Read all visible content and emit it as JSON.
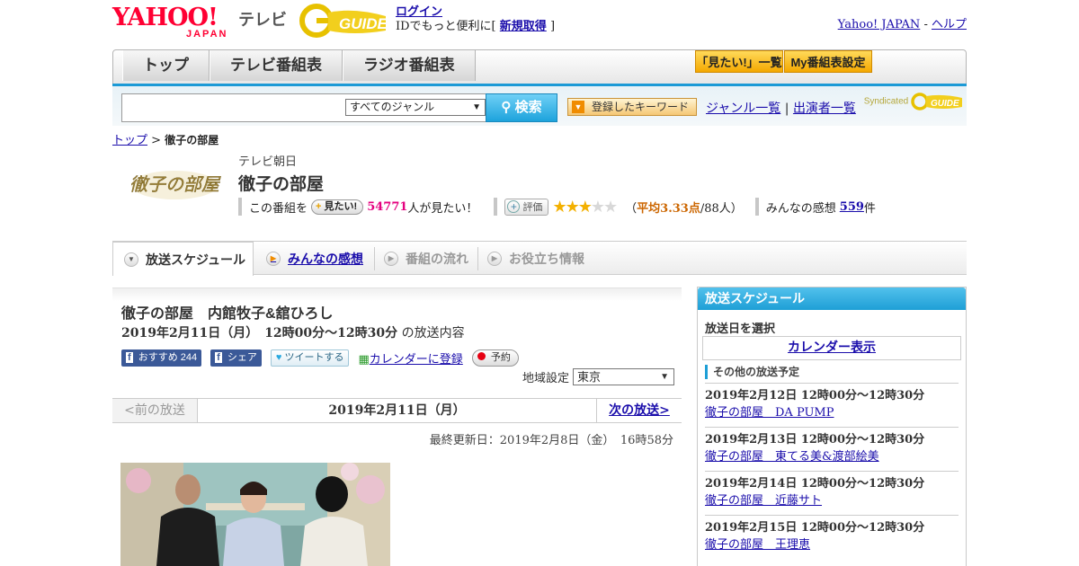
{
  "header": {
    "yahoo_logo": "YAHOO!",
    "yahoo_sub": "JAPAN",
    "tv_label": "テレビ",
    "login": "ログイン",
    "login_desc": "IDでもっと便利に[",
    "register": "新規取得",
    "login_close": "]",
    "yahoo_japan_link": "Yahoo! JAPAN",
    "dash": "-",
    "help_link": "ヘルプ"
  },
  "nav": {
    "tabs": [
      "トップ",
      "テレビ番組表",
      "ラジオ番組表"
    ],
    "mitai_list": "「見たい!」一覧",
    "my_schedule": "My番組表設定"
  },
  "search": {
    "genre": "すべてのジャンル",
    "button": "検索",
    "keyword_button": "登録したキーワード",
    "genre_list": "ジャンル一覧",
    "separator": "|",
    "cast_list": "出演者一覧",
    "syndicated": "Syndicated"
  },
  "breadcrumb": {
    "top": "トップ",
    "sep": ">",
    "current": "徹子の部屋"
  },
  "program": {
    "thumb_text": "徹子の部屋",
    "channel": "テレビ朝日",
    "title": "徹子の部屋",
    "kono_bangumi": "この番組を",
    "mitai_btn": "見たい!",
    "mitai_count": "54771",
    "mitai_suffix": "人が見たい！",
    "hyoka_btn": "評価",
    "rating_stars": 3,
    "rating_max": 5,
    "avg_open": "（",
    "avg_label": "平均3.33点",
    "avg_count": "/88人）",
    "kanso_label": "みんなの感想",
    "kanso_count": "559",
    "kanso_suffix": "件"
  },
  "subtabs": [
    "放送スケジュール",
    "みんなの感想",
    "番組の流れ",
    "お役立ち情報"
  ],
  "episode": {
    "title": "徹子の部屋　内館牧子&舘ひろし",
    "date_bold": "2019年2月11日（月）　12時00分～12時30分",
    "date_suffix": "の放送内容",
    "fb_label": "おすすめ",
    "fb_count": "244",
    "share": "シェア",
    "tweet": "ツイートする",
    "calendar": "カレンダーに登録",
    "yoyaku": "予約",
    "region_label": "地域設定",
    "region_value": "東京"
  },
  "episode_nav": {
    "prev": "<前の放送",
    "current": "2019年2月11日（月）",
    "next": "次の放送>"
  },
  "updated": "最終更新日：2019年2月8日（金）　16時58分",
  "sidebar": {
    "title": "放送スケジュール",
    "date_label": "放送日を選択",
    "calendar_link": "カレンダー表示",
    "other_label": "その他の放送予定",
    "items": [
      {
        "date": "2019年2月12日  12時00分～12時30分",
        "title": "徹子の部屋　DA PUMP"
      },
      {
        "date": "2019年2月13日  12時00分～12時30分",
        "title": "徹子の部屋　東てる美&渡部絵美"
      },
      {
        "date": "2019年2月14日  12時00分～12時30分",
        "title": "徹子の部屋　近藤サト"
      },
      {
        "date": "2019年2月15日  12時00分～12時30分",
        "title": "徹子の部屋　王理恵"
      }
    ]
  },
  "colors": {
    "accent_blue": "#1c9ad6",
    "yahoo_red": "#ff0033",
    "mitai_pink": "#e4007f",
    "star": "#f3b000"
  }
}
